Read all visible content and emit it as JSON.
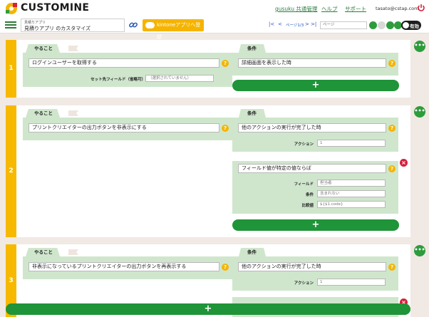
{
  "header": {
    "brand": "CUSTOMINE",
    "links": [
      "gusuku 共通管理",
      "ヘルプ",
      "サポート"
    ],
    "user_email": "tasato@cstap.com"
  },
  "toolbar": {
    "app_small_label": "見積りアプリ",
    "app_name": "見積りアプリ のカスタマイズ",
    "kintone_button": "kintoneアプリへ登録",
    "pager_first": "|<",
    "pager_prev": "<",
    "page_label": "ページ1/3",
    "pager_next": ">",
    "pager_last": ">|",
    "page_input_placeholder": "ページ",
    "toggle_label": "有効"
  },
  "colors": {
    "accent_green": "#1f9438",
    "rule_yellow": "#f7b900",
    "panel_green": "#cfe6cc",
    "delete_red": "#d6203b"
  },
  "labels": {
    "action_tab": "やること",
    "condition_tab": "条件",
    "plus": "+",
    "more": "•••",
    "help": "?",
    "close": "×"
  },
  "rules": [
    {
      "number": "1",
      "action": "ログインユーザーを取得する",
      "action_param_label": "セット先フィールド（省略可）",
      "action_param_value": "（選択されていません）",
      "conditions": [
        {
          "text": "詳細画面を表示した時"
        }
      ]
    },
    {
      "number": "2",
      "action": "プリントクリエイターの出力ボタンを非表示にする",
      "conditions": [
        {
          "text": "他のアクションの実行が完了した時",
          "params": [
            {
              "label": "アクション",
              "value": "1"
            }
          ]
        },
        {
          "text": "フィールド値が特定の値ならば",
          "params": [
            {
              "label": "フィールド",
              "value": "担当者"
            },
            {
              "label": "条件",
              "value": "含まれない"
            },
            {
              "label": "比較値",
              "value": "${$1.code}"
            }
          ]
        }
      ]
    },
    {
      "number": "3",
      "action": "非表示になっているプリントクリエイターの出力ボタンを再表示する",
      "conditions": [
        {
          "text": "他のアクションの実行が完了した時",
          "params": [
            {
              "label": "アクション",
              "value": "1"
            }
          ]
        }
      ]
    }
  ],
  "footer": {
    "add_rule": "+"
  }
}
